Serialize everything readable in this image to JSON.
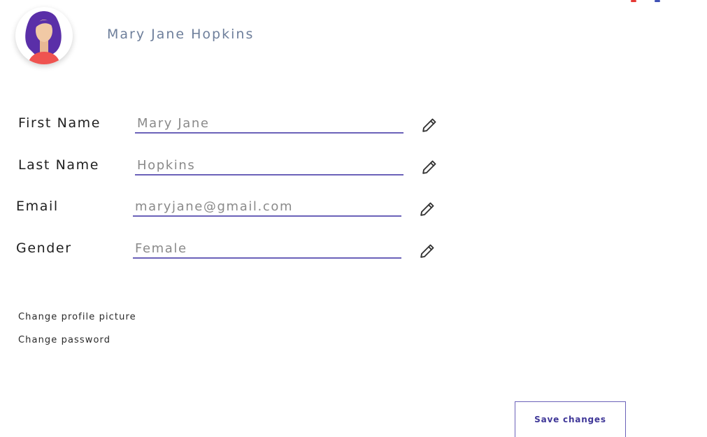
{
  "profile": {
    "name": "Mary Jane Hopkins",
    "avatar_icon": "woman-avatar-icon"
  },
  "fields": [
    {
      "label": "First Name",
      "value": "",
      "placeholder": "Mary Jane",
      "edit_icon": "pencil-icon"
    },
    {
      "label": "Last Name",
      "value": "",
      "placeholder": "Hopkins",
      "edit_icon": "pencil-icon"
    },
    {
      "label": "Email",
      "value": "",
      "placeholder": "maryjane@gmail.com",
      "edit_icon": "pencil-icon"
    },
    {
      "label": "Gender",
      "value": "",
      "placeholder": "Female",
      "edit_icon": "pencil-icon"
    }
  ],
  "links": {
    "change_picture": "Change profile picture",
    "change_password": "Change password"
  },
  "actions": {
    "save_label": "Save changes"
  },
  "colors": {
    "accent": "#6b62b9",
    "accent_text": "#3f3798",
    "name_text": "#6e7f9b",
    "avatar_hair": "#5a2fa8",
    "avatar_shirt": "#ef5350",
    "avatar_skin": "#f1c9a5"
  }
}
